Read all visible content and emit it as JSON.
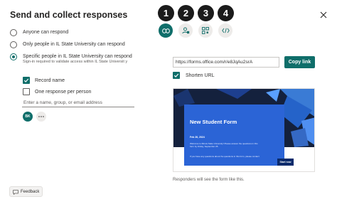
{
  "panel": {
    "title": "Send and collect responses"
  },
  "icons": {
    "close": "close-icon",
    "link": "link-icon",
    "qr": "qr-code-icon",
    "embed": "embed-icon",
    "share": "share-people-icon",
    "feedback": "feedback-icon",
    "more": "ellipsis-icon"
  },
  "audience": {
    "options": [
      {
        "label": "Anyone can respond",
        "selected": false
      },
      {
        "label": "Only people in IL State University can respond",
        "selected": false
      },
      {
        "label": "Specific people in IL State University can respond",
        "selected": true
      }
    ],
    "signin_note": "Sign-in required to validate access within IL State Universit y",
    "record_name": {
      "label": "Record name",
      "checked": true
    },
    "one_response": {
      "label": "One response per person",
      "checked": false
    },
    "people_input": {
      "placeholder": "Enter a name, group, or email address",
      "value": ""
    },
    "avatar_initials": "BK"
  },
  "feedback_label": "Feedback",
  "badges": [
    "1",
    "2",
    "3",
    "4"
  ],
  "send": {
    "link_value": "https://forms.office.com/r/e8JqAu2srA",
    "copy_label": "Copy link",
    "shorten_label": "Shorten URL",
    "shorten_checked": true,
    "footer": "Responders will see the form like this."
  },
  "preview": {
    "form_title": "New Student Form",
    "date_line": "Feb 26, 2024",
    "welcome_text": "Welcome to Illinois State University! Please answer the questions in this form by Friday, September 25.",
    "questions_text": "If you have any questions about the questions in this form, please contact",
    "start_label": "Start now"
  },
  "colors": {
    "accent": "#0f6e6a",
    "badge": "#1b1b1b",
    "preview_banner": "#14213d",
    "preview_panel": "#2b64d6"
  }
}
